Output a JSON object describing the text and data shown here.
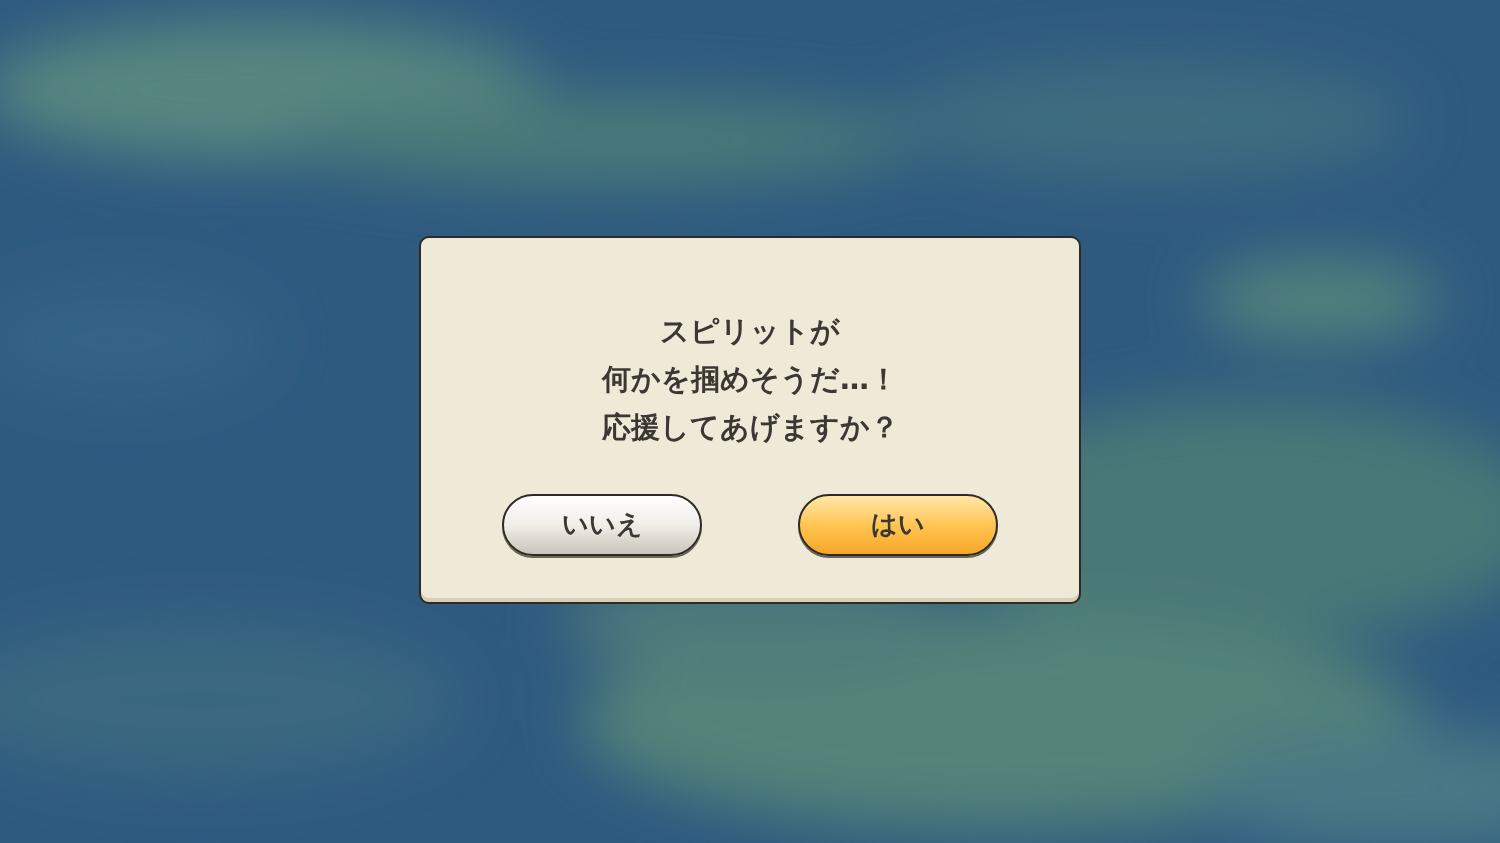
{
  "dialog": {
    "message_lines": [
      "スピリットが",
      "何かを掴めそうだ…！",
      "応援してあげますか？"
    ],
    "buttons": [
      {
        "label": "いいえ",
        "kind": "secondary"
      },
      {
        "label": "はい",
        "kind": "primary"
      }
    ]
  }
}
